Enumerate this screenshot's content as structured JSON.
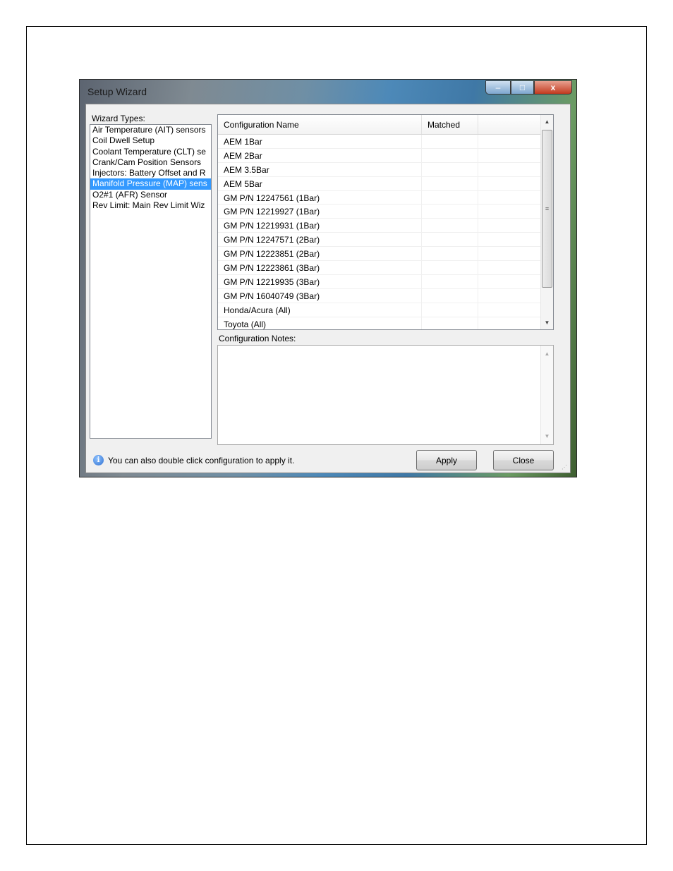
{
  "window": {
    "title": "Setup Wizard",
    "controls": {
      "minimize": "–",
      "maximize": "□",
      "close": "x"
    }
  },
  "wizard_types": {
    "label": "Wizard Types:",
    "items": [
      "Air Temperature (AIT) sensors",
      "Coil Dwell Setup",
      "Coolant Temperature (CLT) se",
      "Crank/Cam Position Sensors",
      "Injectors: Battery Offset and R",
      "Manifold Pressure (MAP) sens",
      "O2#1 (AFR) Sensor",
      "Rev Limit: Main Rev Limit Wiz"
    ],
    "selected_index": 5
  },
  "config_table": {
    "columns": [
      "Configuration Name",
      "Matched",
      ""
    ],
    "rows": [
      "AEM 1Bar",
      "AEM 2Bar",
      "AEM 3.5Bar",
      "AEM 5Bar",
      "GM P/N 12247561 (1Bar)",
      "GM P/N 12219927 (1Bar)",
      "GM P/N 12219931 (1Bar)",
      "GM P/N 12247571 (2Bar)",
      "GM P/N 12223851 (2Bar)",
      "GM P/N 12223861 (3Bar)",
      "GM P/N 12219935 (3Bar)",
      "GM P/N 16040749 (3Bar)",
      "Honda/Acura (All)",
      "Toyota (All)"
    ]
  },
  "notes": {
    "label": "Configuration Notes:",
    "value": ""
  },
  "status": {
    "text": "You can also double click configuration to apply it.",
    "icon": "info-icon"
  },
  "buttons": {
    "apply": "Apply",
    "close": "Close"
  },
  "scroll_glyphs": {
    "up": "▲",
    "down": "▼",
    "grip": "≡",
    "resize": "⋰"
  }
}
